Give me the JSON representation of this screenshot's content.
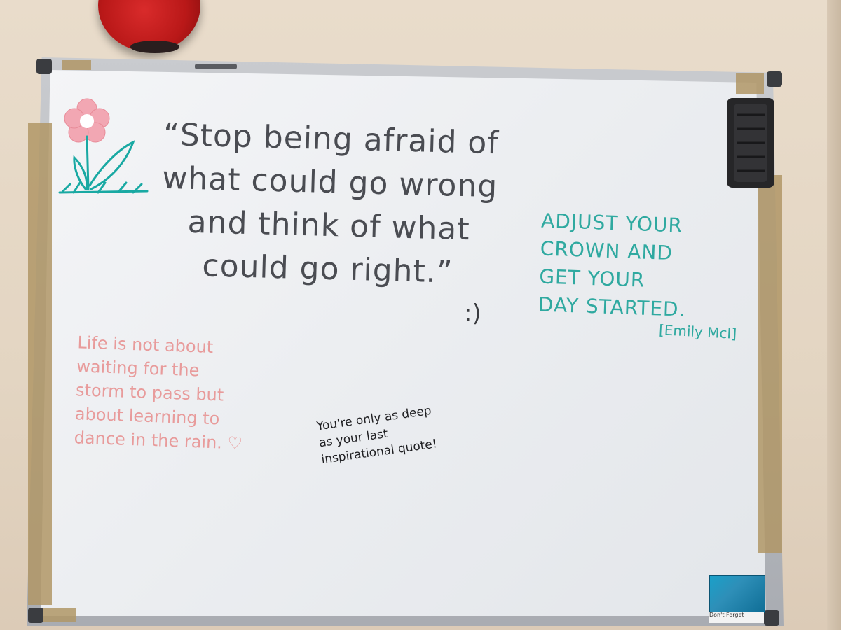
{
  "scene": {
    "main_quote": "“Stop being afraid of\nwhat could go wrong\nand think of what\ncould go right.”",
    "smiley": ":)",
    "teal_quote": "ADJUST YOUR\nCROWN AND\nGET YOUR\nDAY STARTED.",
    "attribution": "[Emily McI]",
    "pink_quote": "Life is not about\nwaiting for the\nstorm to pass but\nabout learning to\ndance in the rain. ♡",
    "black_quote": "You're only as deep\nas your last\ninspirational quote!",
    "sticker_text": "Don't Forget"
  },
  "colors": {
    "main_ink": "#4a4c52",
    "teal_ink": "#2fa9a0",
    "pink_ink": "#e89b9b",
    "black_ink": "#1f1f22",
    "flower_pink": "#f2a7b3",
    "leaf_teal": "#19a9a3",
    "bell_red": "#c41b1b"
  },
  "icons": [
    "alarm-bell",
    "flower-doodle",
    "eraser",
    "heart-doodle",
    "smiley-doodle"
  ]
}
